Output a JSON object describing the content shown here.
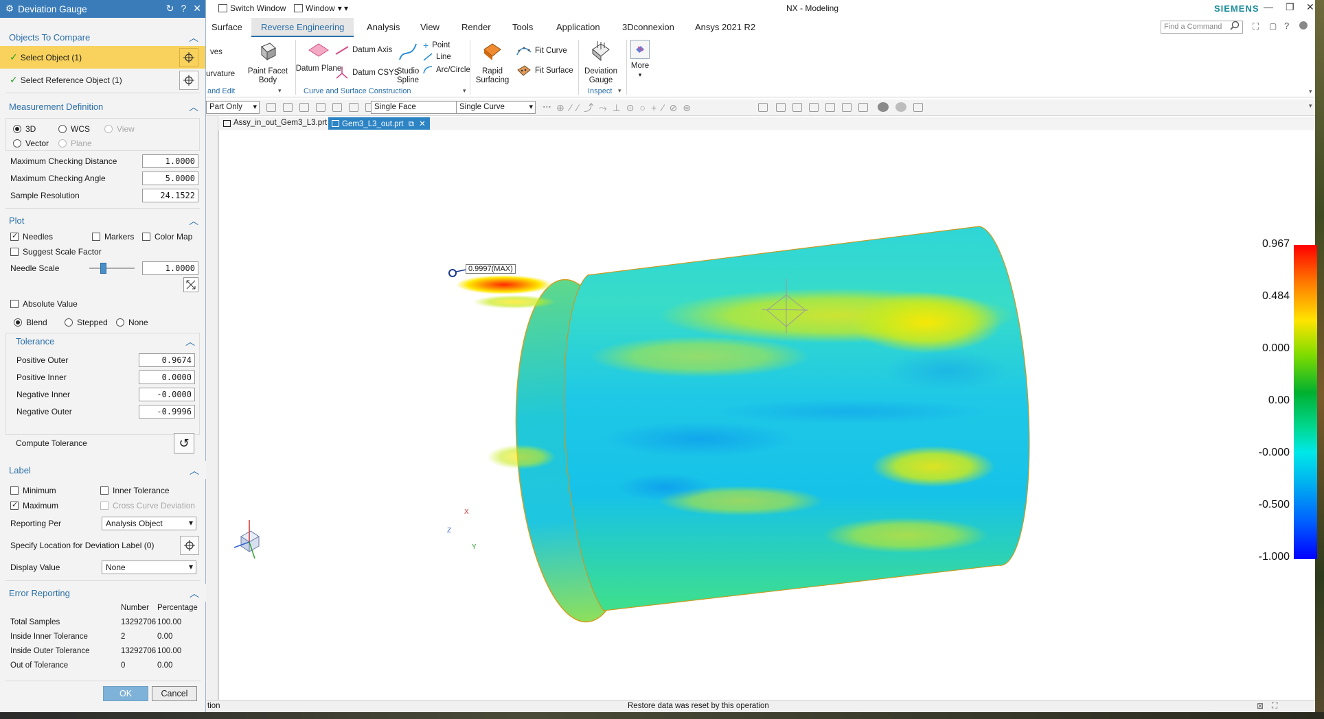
{
  "window": {
    "app_title": "NX - Modeling",
    "brand": "SIEMENS",
    "switch_window": "Switch Window",
    "window_menu": "Window"
  },
  "ribbon": {
    "tabs": [
      "Surface",
      "Reverse Engineering",
      "Analysis",
      "View",
      "Render",
      "Tools",
      "Application",
      "3Dconnexion",
      "Ansys 2021 R2"
    ],
    "active_tab": "Reverse Engineering",
    "search_placeholder": "Find a Command",
    "partial_left": {
      "ves": "ves",
      "urvature": "urvature",
      "and_edit": "and Edit"
    },
    "paint_facet_body": "Paint Facet Body",
    "datum_plane": "Datum Plane",
    "datum_axis": "Datum Axis",
    "datum_csys": "Datum CSYS",
    "studio_spline": "Studio Spline",
    "point": "Point",
    "line": "Line",
    "arc_circle": "Arc/Circle",
    "rapid_surfacing": "Rapid Surfacing",
    "fit_curve": "Fit Curve",
    "fit_surface": "Fit Surface",
    "deviation_gauge": "Deviation Gauge",
    "more": "More",
    "group_curve": "Curve and Surface Construction",
    "group_inspect": "Inspect"
  },
  "selection_bar": {
    "filter": "Part Only",
    "face_rule": "Single Face",
    "curve_rule": "Single Curve"
  },
  "doc_tabs": [
    {
      "label": "Assy_in_out_Gem3_L3.prt",
      "active": false
    },
    {
      "label": "Gem3_L3_out.prt",
      "active": true
    }
  ],
  "dialog": {
    "title": "Deviation Gauge",
    "objects": {
      "header": "Objects To Compare",
      "select_object": "Select Object (1)",
      "select_reference": "Select Reference Object (1)"
    },
    "measurement": {
      "header": "Measurement Definition",
      "opt_3d": "3D",
      "opt_wcs": "WCS",
      "opt_view": "View",
      "opt_vector": "Vector",
      "opt_plane": "Plane",
      "max_dist_label": "Maximum Checking Distance",
      "max_dist": "1.0000",
      "max_angle_label": "Maximum Checking Angle",
      "max_angle": "5.0000",
      "sample_label": "Sample Resolution",
      "sample": "24.1522"
    },
    "plot": {
      "header": "Plot",
      "needles": "Needles",
      "markers": "Markers",
      "color_map": "Color Map",
      "suggest": "Suggest Scale Factor",
      "needle_scale_label": "Needle Scale",
      "needle_scale": "1.0000",
      "needle_scale_level": 0.3,
      "absolute": "Absolute Value",
      "blend": "Blend",
      "stepped": "Stepped",
      "none": "None"
    },
    "tolerance": {
      "header": "Tolerance",
      "pos_outer_label": "Positive Outer",
      "pos_outer": "0.9674",
      "pos_inner_label": "Positive Inner",
      "pos_inner": "0.0000",
      "neg_inner_label": "Negative Inner",
      "neg_inner": "-0.0000",
      "neg_outer_label": "Negative Outer",
      "neg_outer": "-0.9996",
      "compute": "Compute Tolerance"
    },
    "label": {
      "header": "Label",
      "minimum": "Minimum",
      "inner_tol": "Inner Tolerance",
      "maximum": "Maximum",
      "cross_curve": "Cross Curve Deviation",
      "reporting_per_label": "Reporting Per",
      "reporting_per": "Analysis Object",
      "specify_loc": "Specify Location for Deviation Label (0)",
      "display_value_label": "Display Value",
      "display_value": "None"
    },
    "errors": {
      "header": "Error Reporting",
      "col_number": "Number",
      "col_pct": "Percentage",
      "rows": [
        {
          "label": "Total Samples",
          "number": "13292706",
          "pct": "100.00"
        },
        {
          "label": "Inside Inner Tolerance",
          "number": "2",
          "pct": "0.00"
        },
        {
          "label": "Inside Outer Tolerance",
          "number": "13292706",
          "pct": "100.00"
        },
        {
          "label": "Out of Tolerance",
          "number": "0",
          "pct": "0.00"
        }
      ]
    },
    "ok": "OK",
    "cancel": "Cancel"
  },
  "viewport": {
    "max_label": "0.9997(MAX)",
    "legend": [
      "0.967",
      "0.484",
      "0.000",
      "0.00",
      "-0.000",
      "-0.500",
      "-1.000"
    ],
    "triad": {
      "x": "X",
      "y": "Y",
      "z": "Z"
    }
  },
  "status": {
    "left": "tion",
    "message": "Restore data was reset by this operation"
  },
  "colors": {
    "accent": "#2a6fa8",
    "dialog_title": "#3a7cb9",
    "selected_row": "#f8d25c"
  }
}
